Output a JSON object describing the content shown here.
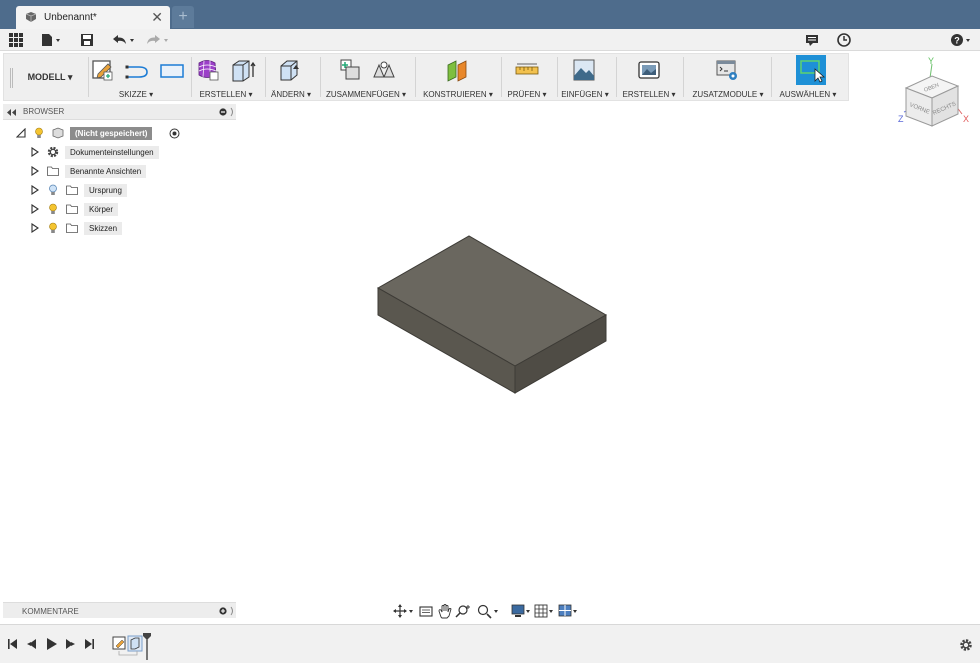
{
  "tab": {
    "title": "Unbenannt*",
    "close": "✕",
    "new": "+"
  },
  "quick": {
    "undo_arrow": "▾",
    "redo_arrow": "▾",
    "help_arrow": "▾"
  },
  "ribbon": {
    "workspace": "MODELL ▾",
    "groups": [
      "SKIZZE ▾",
      "ERSTELLEN ▾",
      "ÄNDERN ▾",
      "ZUSAMMENFÜGEN ▾",
      "KONSTRUIEREN ▾",
      "PRÜFEN ▾",
      "EINFÜGEN ▾",
      "ERSTELLEN ▾",
      "ZUSATZMODULE ▾",
      "AUSWÄHLEN ▾"
    ]
  },
  "browser": {
    "title": "BROWSER",
    "root": "(Nicht gespeichert)",
    "items": [
      {
        "label": "Dokumenteinstellungen"
      },
      {
        "label": "Benannte Ansichten"
      },
      {
        "label": "Ursprung"
      },
      {
        "label": "Körper"
      },
      {
        "label": "Skizzen"
      }
    ]
  },
  "viewcube": {
    "top": "OBEN",
    "front": "VORNE",
    "right": "RECHTS",
    "x": "X",
    "y": "Y",
    "z": "Z"
  },
  "comments": {
    "title": "KOMMENTARE"
  },
  "colors": {
    "titlebar": "#4e6c8c",
    "select_accent": "#1e90d6",
    "body": "#67645c"
  }
}
